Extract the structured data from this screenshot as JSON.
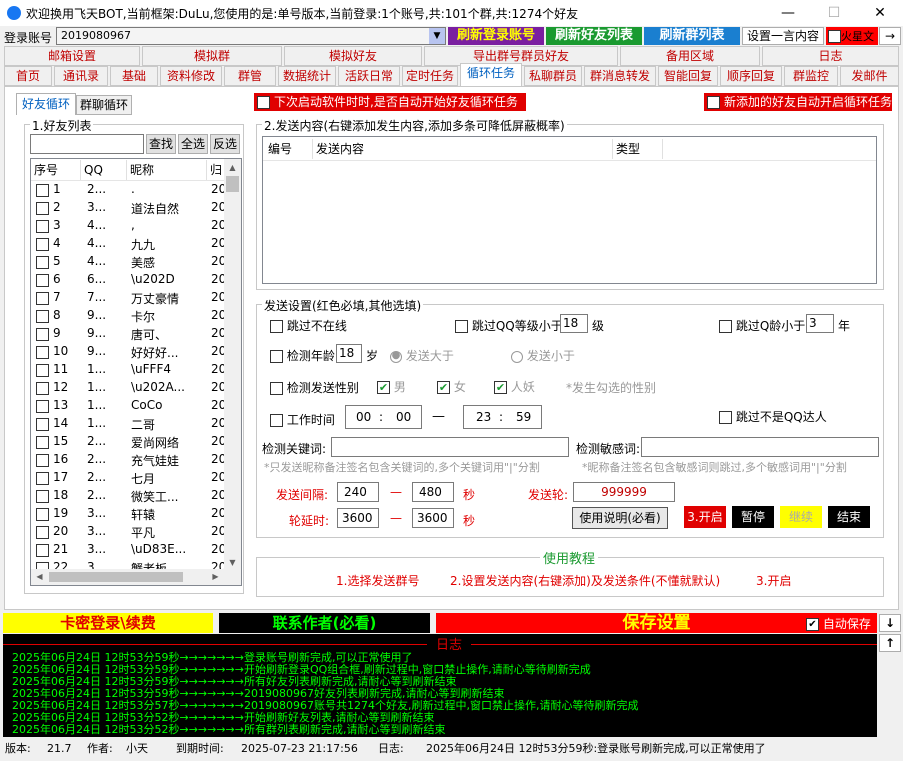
{
  "window": {
    "title": "欢迎换用飞天BOT,当前框架:DuLu,您使用的是:单号版本,当前登录:1个账号,共:101个群,共:1274个好友",
    "minimize": "—",
    "maximize": "☐",
    "close": "✕"
  },
  "topbar": {
    "account_label": "登录账号",
    "account_value": "2019080967",
    "refresh_login": "刷新登录账号",
    "refresh_friends": "刷新好友列表",
    "refresh_groups": "刷新群列表",
    "set_one_line": "设置一言内容",
    "mars_text": "火星文",
    "arrow": "→"
  },
  "tabs_row1": [
    "邮箱设置",
    "模拟群",
    "模拟好友",
    "导出群号群员好友",
    "备用区域",
    "日志"
  ],
  "tabs_row2": [
    "首页",
    "通讯录",
    "基础",
    "资料修改",
    "群管",
    "数据统计",
    "活跃日常",
    "定时任务",
    "循环任务",
    "私聊群员",
    "群消息转发",
    "智能回复",
    "顺序回复",
    "群监控",
    "发邮件"
  ],
  "subtabs": {
    "friend_loop": "好友循环",
    "group_loop": "群聊循环"
  },
  "banners": {
    "auto_start": "下次启动软件时时,是否自动开始好友循环任务",
    "new_friends": "新添加的好友自动开启循环任务"
  },
  "friend_list": {
    "group_title": "1.好友列表",
    "search": "查找",
    "select_all": "全选",
    "invert": "反选",
    "headers": [
      "序号",
      "QQ",
      "昵称",
      "归"
    ],
    "rows": [
      {
        "no": "1",
        "qq": "2...",
        "nick": ".",
        "g": "20"
      },
      {
        "no": "2",
        "qq": "3...",
        "nick": "道法自然",
        "g": "20"
      },
      {
        "no": "3",
        "qq": "4...",
        "nick": ",",
        "g": "20"
      },
      {
        "no": "4",
        "qq": "4...",
        "nick": "九九",
        "g": "20"
      },
      {
        "no": "5",
        "qq": "4...",
        "nick": "美感",
        "g": "20"
      },
      {
        "no": "6",
        "qq": "6...",
        "nick": "\\u202D",
        "g": "20"
      },
      {
        "no": "7",
        "qq": "7...",
        "nick": "万丈豪情",
        "g": "20"
      },
      {
        "no": "8",
        "qq": "9...",
        "nick": "卡尔",
        "g": "20"
      },
      {
        "no": "9",
        "qq": "9...",
        "nick": "唐可、",
        "g": "20"
      },
      {
        "no": "10",
        "qq": "9...",
        "nick": "好好好...",
        "g": "20"
      },
      {
        "no": "11",
        "qq": "1...",
        "nick": "\\uFFF4",
        "g": "20"
      },
      {
        "no": "12",
        "qq": "1...",
        "nick": "\\u202A...",
        "g": "20"
      },
      {
        "no": "13",
        "qq": "1...",
        "nick": "CoCo",
        "g": "20"
      },
      {
        "no": "14",
        "qq": "1...",
        "nick": "二哥",
        "g": "20"
      },
      {
        "no": "15",
        "qq": "2...",
        "nick": "爱尚网络",
        "g": "20"
      },
      {
        "no": "16",
        "qq": "2...",
        "nick": "充气娃娃",
        "g": "20"
      },
      {
        "no": "17",
        "qq": "2...",
        "nick": "七月",
        "g": "20"
      },
      {
        "no": "18",
        "qq": "2...",
        "nick": "微笑工...",
        "g": "20"
      },
      {
        "no": "19",
        "qq": "3...",
        "nick": "轩辕",
        "g": "20"
      },
      {
        "no": "20",
        "qq": "3...",
        "nick": "平凡",
        "g": "20"
      },
      {
        "no": "21",
        "qq": "3...",
        "nick": "\\uD83E...",
        "g": "20"
      },
      {
        "no": "22",
        "qq": "3...",
        "nick": "蟹老板",
        "g": "20"
      }
    ]
  },
  "send_content": {
    "group_title": "2.发送内容(右键添加发生内容,添加多条可降低屏蔽概率)",
    "headers": [
      "编号",
      "发送内容",
      "类型"
    ]
  },
  "send_settings": {
    "group_title": "发送设置(红色必填,其他选填)",
    "skip_offline": "跳过不在线",
    "skip_qq_level": "跳过QQ等级小于",
    "qq_level_value": "18",
    "level_unit": "级",
    "skip_qq_age": "跳过Q龄小于",
    "qq_age_value": "3",
    "year_unit": "年",
    "check_age": "检测年龄",
    "age_value": "18",
    "age_unit": "岁",
    "send_greater": "发送大于",
    "send_less": "发送小于",
    "check_gender": "检测发送性别",
    "male": "男",
    "female": "女",
    "monster": "人妖",
    "gender_note": "*发生勾选的性别",
    "work_time": "工作时间",
    "start_hour": "00",
    "start_min": "00",
    "end_hour": "23",
    "end_min": "59",
    "colon": ":",
    "dash": "—",
    "skip_not_expert": "跳过不是QQ达人",
    "keyword_label": "检测关键词:",
    "keyword_note": "*只发送昵称备注签名包含关键词的,多个关键词用\"|\"分割",
    "sensitive_label": "检测敏感词:",
    "sensitive_note": "*昵称备注签名包含敏感词则跳过,多个敏感词用\"|\"分割",
    "interval_label": "发送间隔:",
    "interval_from": "240",
    "interval_to": "480",
    "second_unit": "秒",
    "round_label": "发送轮:",
    "round_value": "999999",
    "round_delay_label": "轮延时:",
    "delay_from": "3600",
    "delay_to": "3600",
    "usage_btn": "使用说明(必看)",
    "start_btn": "3.开启",
    "pause_btn": "暂停",
    "continue_btn": "继续",
    "end_btn": "结束"
  },
  "tutorial": {
    "title": "使用教程",
    "step1": "1.选择发送群号",
    "step2": "2.设置发送内容(右键添加)及发送条件(不懂就默认)",
    "step3": "3.开启"
  },
  "bottom_bar": {
    "card_login": "卡密登录\\续费",
    "contact_author": "联系作者(必看)",
    "save_settings": "保存设置",
    "auto_save": "自动保存",
    "down": "↓",
    "up": "↑"
  },
  "log": {
    "title": "日志",
    "lines": [
      "2025年06月24日  12时53分59秒→→→→→→→登录账号刷新完成,可以正常使用了",
      "2025年06月24日  12时53分59秒→→→→→→→开始刷新登录QQ组合框,刷新过程中,窗口禁止操作,请耐心等待刷新完成",
      "2025年06月24日  12时53分59秒→→→→→→→所有好友列表刷新完成,请耐心等到刷新结束",
      "2025年06月24日  12时53分59秒→→→→→→→2019080967好友列表刷新完成,请耐心等到刷新结束",
      "2025年06月24日  12时53分57秒→→→→→→→2019080967账号共1274个好友,刷新过程中,窗口禁止操作,请耐心等待刷新完成",
      "2025年06月24日  12时53分52秒→→→→→→→开始刷新好友列表,请耐心等到刷新结束",
      "2025年06月24日  12时53分52秒→→→→→→→所有群列表刷新完成,请耐心等到刷新结束"
    ]
  },
  "statusbar": {
    "version_label": "版本:",
    "version": "21.7",
    "author_label": "作者:",
    "author": "小天",
    "expire_label": "到期时间:",
    "expire": "2025-07-23 21:17:56",
    "log_label": "日志:",
    "log": "2025年06月24日 12时53分59秒:登录账号刷新完成,可以正常使用了"
  }
}
